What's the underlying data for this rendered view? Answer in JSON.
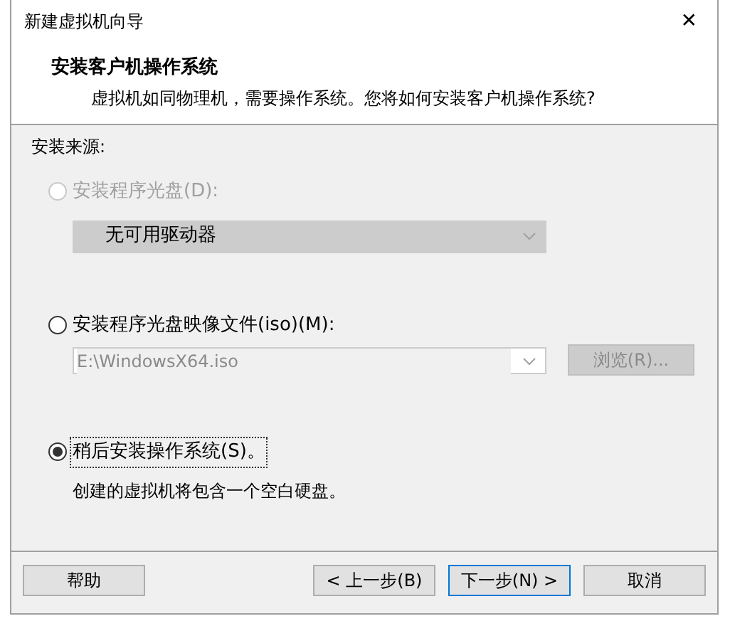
{
  "window": {
    "title": "新建虚拟机向导",
    "close": "✕"
  },
  "header": {
    "title": "安装客户机操作系统",
    "subtitle": "虚拟机如同物理机，需要操作系统。您将如何安装客户机操作系统?"
  },
  "source_label": "安装来源:",
  "options": [
    {
      "kind": "drive",
      "label": "安装程序光盘(D):",
      "selected": false,
      "disabled": true,
      "dropdown": {
        "value": "无可用驱动器",
        "disabled": true
      }
    },
    {
      "kind": "iso",
      "label": "安装程序光盘映像文件(iso)(M):",
      "selected": false,
      "disabled": false,
      "dropdown": {
        "value": "E:\\WindowsX64.iso",
        "disabled": true
      },
      "browse": {
        "label": "浏览(R)...",
        "disabled": true
      }
    },
    {
      "kind": "later",
      "label": "稍后安装操作系统(S)。",
      "selected": true,
      "disabled": false,
      "note": "创建的虚拟机将包含一个空白硬盘。"
    }
  ],
  "buttons": [
    {
      "kind": "help",
      "label": "帮助",
      "focused": false
    },
    {
      "kind": "back",
      "label": "< 上一步(B)",
      "focused": false
    },
    {
      "kind": "next",
      "label": "下一步(N) >",
      "focused": true
    },
    {
      "kind": "cancel",
      "label": "取消",
      "focused": false
    }
  ]
}
